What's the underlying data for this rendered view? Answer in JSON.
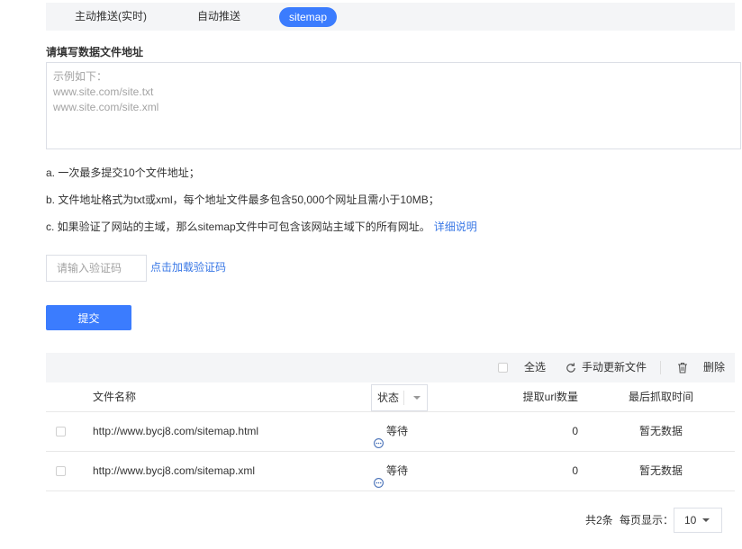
{
  "tabs": [
    {
      "label": "主动推送(实时)",
      "active": false
    },
    {
      "label": "自动推送",
      "active": false
    },
    {
      "label": "sitemap",
      "active": true
    }
  ],
  "form": {
    "label": "请填写数据文件地址",
    "placeholder_lines": [
      "示例如下：",
      "www.site.com/site.txt",
      "www.site.com/site.xml"
    ],
    "notes": [
      "a. 一次最多提交10个文件地址；",
      "b. 文件地址格式为txt或xml，每个地址文件最多包含50,000个网址且需小于10MB；",
      "c. 如果验证了网站的主域，那么sitemap文件中可包含该网站主域下的所有网址。"
    ],
    "note_link": "详细说明",
    "captcha_placeholder": "请输入验证码",
    "captcha_link": "点击加载验证码",
    "submit_label": "提交"
  },
  "table": {
    "toolbar": {
      "select_all": "全选",
      "refresh": "手动更新文件",
      "delete": "删除"
    },
    "columns": {
      "name": "文件名称",
      "status": "状态",
      "url_count": "提取url数量",
      "last_crawl": "最后抓取时间"
    },
    "rows": [
      {
        "url": "http://www.bycj8.com/sitemap.html",
        "status": "等待",
        "url_count": 0,
        "last_crawl": "暂无数据"
      },
      {
        "url": "http://www.bycj8.com/sitemap.xml",
        "status": "等待",
        "url_count": 0,
        "last_crawl": "暂无数据"
      }
    ]
  },
  "pagination": {
    "total": "共2条",
    "per_page_label": "每页显示：",
    "per_page_value": "10"
  },
  "icons": {
    "refresh": "refresh-icon",
    "delete": "trash-icon",
    "status_waiting": "waiting-icon",
    "dropdown": "caret-down-icon"
  },
  "colors": {
    "accent": "#3b7cfe",
    "link": "#3a78e6",
    "text": "#333333",
    "placeholder": "#a3a3a3",
    "border": "#dcdfe6",
    "panel": "#f4f5f7",
    "icon": "#555555",
    "status": "#4a73b9"
  }
}
